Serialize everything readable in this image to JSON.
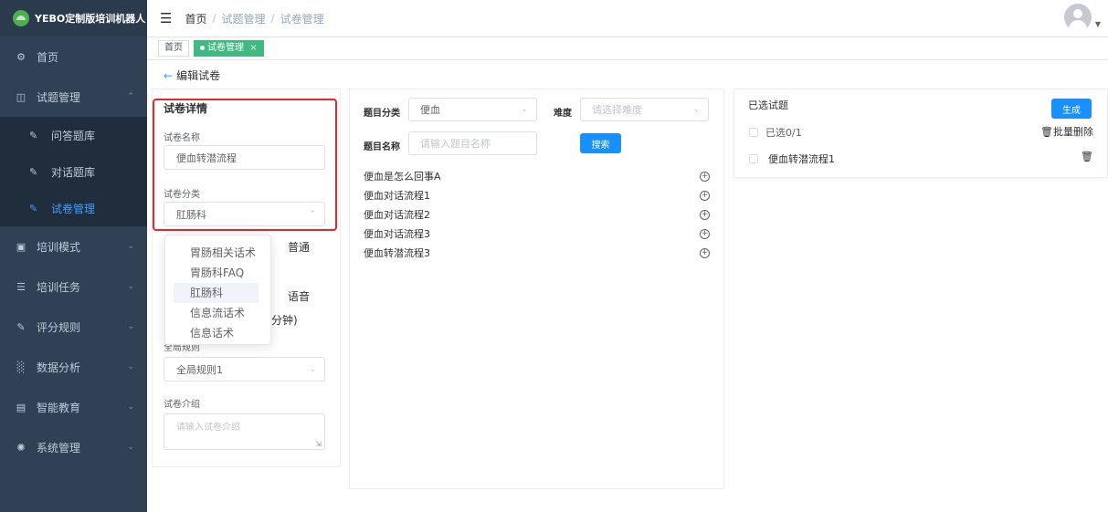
{
  "brand": {
    "name": "YEBO定制版培训机器人"
  },
  "sidebar": {
    "home": "首页",
    "question_mgmt": "试题管理",
    "sub_items": [
      "问答题库",
      "对话题库",
      "试卷管理"
    ],
    "items": [
      "培训模式",
      "培训任务",
      "评分规则",
      "数据分析",
      "智能教育",
      "系统管理"
    ]
  },
  "header": {
    "breadcrumb": [
      "首页",
      "试题管理",
      "试卷管理"
    ]
  },
  "tags": {
    "home": "首页",
    "active": "试卷管理",
    "close": "×"
  },
  "page": {
    "back_label": "编辑试卷"
  },
  "details": {
    "title": "试卷详情",
    "name_label": "试卷名称",
    "name_value": "便血转潜流程",
    "category_label": "试卷分类",
    "category_value": "肛肠科",
    "radio_normal": "普通",
    "radio_voice": "语音",
    "duration_suffix": "分钟)",
    "rule_label": "全局规则",
    "rule_value": "全局规则1",
    "intro_label": "试卷介绍",
    "intro_placeholder": "请输入试卷介绍"
  },
  "category_dropdown": {
    "options": [
      "胃肠相关话术",
      "胃肠科FAQ",
      "肛肠科",
      "信息流话术",
      "信息话术"
    ],
    "selected": "肛肠科"
  },
  "filters": {
    "category_label": "题目分类",
    "category_value": "便血",
    "difficulty_label": "难度",
    "difficulty_placeholder": "请选择难度",
    "name_label": "题目名称",
    "name_placeholder": "请输入题目名称",
    "search_button": "搜索"
  },
  "questions": [
    "便血是怎么回事A",
    "便血对话流程1",
    "便血对话流程2",
    "便血对话流程3",
    "便血转潜流程3"
  ],
  "selected_panel": {
    "title": "已选试题",
    "generate_button": "生成",
    "count_label": "已选0/1",
    "batch_delete": "批量删除",
    "items": [
      "便血转潜流程1"
    ]
  },
  "colors": {
    "sidebar_bg": "#304156",
    "accent": "#409eff",
    "tag_active": "#42b983",
    "highlight": "#e8262b"
  }
}
